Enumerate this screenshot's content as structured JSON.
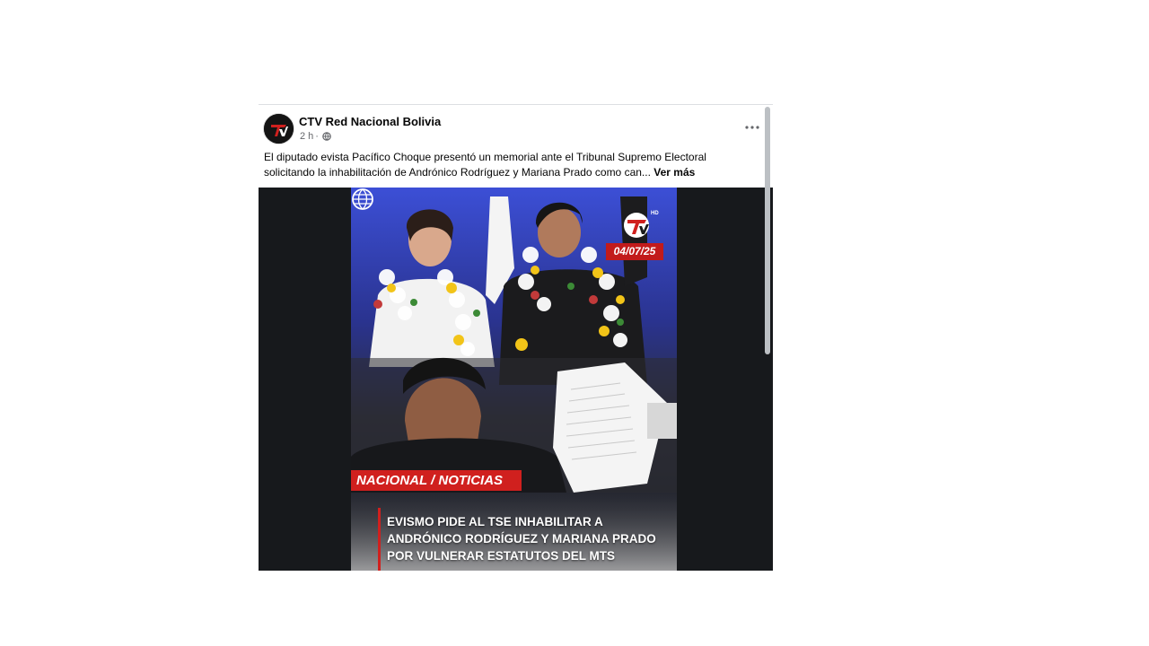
{
  "post": {
    "page_name": "CTV Red Nacional Bolivia",
    "time": "2 h",
    "separator": "·",
    "caption_text": "El diputado evista Pacífico Choque presentó un memorial ante el Tribunal Supremo Electoral solicitando la inhabilitación de Andrónico Rodríguez y Mariana Prado como can...",
    "see_more": "Ver más"
  },
  "image": {
    "date_badge": "04/07/25",
    "section_tag": "NACIONAL / NOTICIAS",
    "headline_lines": [
      "EVISMO PIDE AL TSE INHABILITAR A",
      "ANDRÓNICO RODRÍGUEZ Y MARIANA PRADO",
      "POR VULNERAR ESTATUTOS DEL MTS"
    ],
    "logo_text": "TV",
    "logo_hd": "HD"
  },
  "icons": {
    "more": "more-options-icon",
    "audience": "globe-icon"
  },
  "colors": {
    "accent_red": "#d0201e",
    "media_bg": "#17191c",
    "text_secondary": "#65676b"
  }
}
